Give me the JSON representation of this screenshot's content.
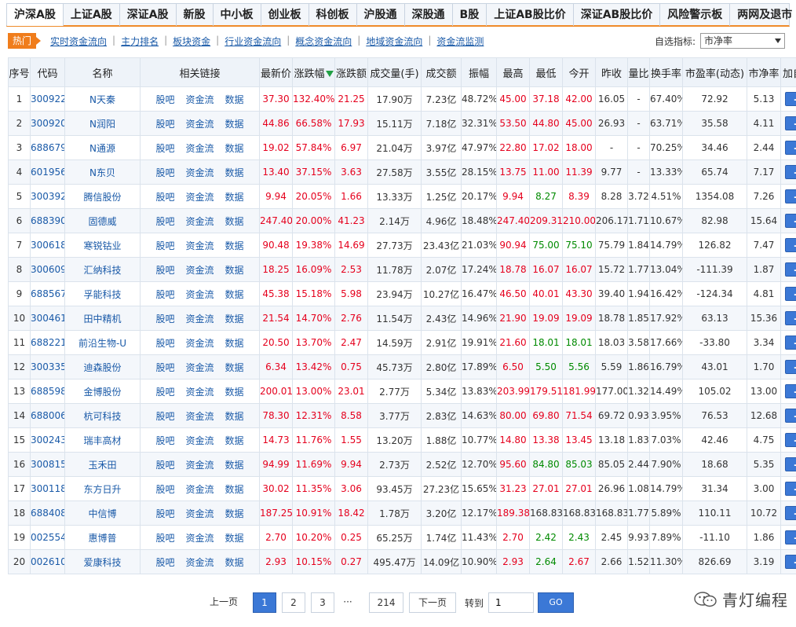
{
  "tabs": [
    "沪深A股",
    "上证A股",
    "深证A股",
    "新股",
    "中小板",
    "创业板",
    "科创板",
    "沪股通",
    "深股通",
    "B股",
    "上证AB股比价",
    "深证AB股比价",
    "风险警示板",
    "两网及退市"
  ],
  "subnav": {
    "hot": "热门",
    "links": [
      "实时资金流向",
      "主力排名",
      "板块资金",
      "行业资金流向",
      "概念资金流向",
      "地域资金流向",
      "资金流监测"
    ],
    "selector_label": "自选指标:",
    "selector_value": "市净率"
  },
  "table": {
    "headers": [
      "序号",
      "代码",
      "名称",
      "相关链接",
      "最新价",
      "涨跌幅",
      "涨跌额",
      "成交量(手)",
      "成交额",
      "振幅",
      "最高",
      "最低",
      "今开",
      "昨收",
      "量比",
      "换手率",
      "市盈率(动态)",
      "市净率",
      "加自选"
    ],
    "link_labels": [
      "股吧",
      "资金流",
      "数据"
    ],
    "add_label": "+",
    "rows": [
      {
        "no": "1",
        "code": "300922",
        "name": "N天秦",
        "price": "37.30",
        "pct": "132.40%",
        "chg": "21.25",
        "vol": "17.90万",
        "amt": "7.23亿",
        "amp": "48.72%",
        "high": "45.00",
        "low": "37.18",
        "open": "42.00",
        "prev": "16.05",
        "vr": "-",
        "turn": "67.40%",
        "pe": "72.92",
        "pb": "5.13",
        "cl": "rrrrrr"
      },
      {
        "no": "2",
        "code": "300920",
        "name": "N润阳",
        "price": "44.86",
        "pct": "66.58%",
        "chg": "17.93",
        "vol": "15.11万",
        "amt": "7.18亿",
        "amp": "32.31%",
        "high": "53.50",
        "low": "44.80",
        "open": "45.00",
        "prev": "26.93",
        "vr": "-",
        "turn": "63.71%",
        "pe": "35.58",
        "pb": "4.11",
        "cl": "rrrrrr"
      },
      {
        "no": "3",
        "code": "688679",
        "name": "N通源",
        "price": "19.02",
        "pct": "57.84%",
        "chg": "6.97",
        "vol": "21.04万",
        "amt": "3.97亿",
        "amp": "47.97%",
        "high": "22.80",
        "low": "17.02",
        "open": "18.00",
        "prev": "-",
        "vr": "-",
        "turn": "70.25%",
        "pe": "34.46",
        "pb": "2.44",
        "cl": "rrrrrr"
      },
      {
        "no": "4",
        "code": "601956",
        "name": "N东贝",
        "price": "13.40",
        "pct": "37.15%",
        "chg": "3.63",
        "vol": "27.58万",
        "amt": "3.55亿",
        "amp": "28.15%",
        "high": "13.75",
        "low": "11.00",
        "open": "11.39",
        "prev": "9.77",
        "vr": "-",
        "turn": "13.33%",
        "pe": "65.74",
        "pb": "7.17",
        "cl": "rrrrrr"
      },
      {
        "no": "5",
        "code": "300392",
        "name": "腾信股份",
        "price": "9.94",
        "pct": "20.05%",
        "chg": "1.66",
        "vol": "13.33万",
        "amt": "1.25亿",
        "amp": "20.17%",
        "high": "9.94",
        "low": "8.27",
        "open": "8.39",
        "prev": "8.28",
        "vr": "3.72",
        "turn": "4.51%",
        "pe": "1354.08",
        "pb": "7.26",
        "cl": "rrrrgr"
      },
      {
        "no": "6",
        "code": "688390",
        "name": "固德威",
        "price": "247.40",
        "pct": "20.00%",
        "chg": "41.23",
        "vol": "2.14万",
        "amt": "4.96亿",
        "amp": "18.48%",
        "high": "247.40",
        "low": "209.31",
        "open": "210.00",
        "prev": "206.17",
        "vr": "1.71",
        "turn": "10.67%",
        "pe": "82.98",
        "pb": "15.64",
        "cl": "rrrrrr"
      },
      {
        "no": "7",
        "code": "300618",
        "name": "寒锐钴业",
        "price": "90.48",
        "pct": "19.38%",
        "chg": "14.69",
        "vol": "27.73万",
        "amt": "23.43亿",
        "amp": "21.03%",
        "high": "90.94",
        "low": "75.00",
        "open": "75.10",
        "prev": "75.79",
        "vr": "1.84",
        "turn": "14.79%",
        "pe": "126.82",
        "pb": "7.47",
        "cl": "rrrrgg"
      },
      {
        "no": "8",
        "code": "300609",
        "name": "汇纳科技",
        "price": "18.25",
        "pct": "16.09%",
        "chg": "2.53",
        "vol": "11.78万",
        "amt": "2.07亿",
        "amp": "17.24%",
        "high": "18.78",
        "low": "16.07",
        "open": "16.07",
        "prev": "15.72",
        "vr": "1.77",
        "turn": "13.04%",
        "pe": "-111.39",
        "pb": "1.87",
        "cl": "rrrrrr"
      },
      {
        "no": "9",
        "code": "688567",
        "name": "孚能科技",
        "price": "45.38",
        "pct": "15.18%",
        "chg": "5.98",
        "vol": "23.94万",
        "amt": "10.27亿",
        "amp": "16.47%",
        "high": "46.50",
        "low": "40.01",
        "open": "43.30",
        "prev": "39.40",
        "vr": "1.94",
        "turn": "16.42%",
        "pe": "-124.34",
        "pb": "4.81",
        "cl": "rrrrrr"
      },
      {
        "no": "10",
        "code": "300461",
        "name": "田中精机",
        "price": "21.54",
        "pct": "14.70%",
        "chg": "2.76",
        "vol": "11.54万",
        "amt": "2.43亿",
        "amp": "14.96%",
        "high": "21.90",
        "low": "19.09",
        "open": "19.09",
        "prev": "18.78",
        "vr": "1.85",
        "turn": "17.92%",
        "pe": "63.13",
        "pb": "15.36",
        "cl": "rrrrrr"
      },
      {
        "no": "11",
        "code": "688221",
        "name": "前沿生物-U",
        "price": "20.50",
        "pct": "13.70%",
        "chg": "2.47",
        "vol": "14.59万",
        "amt": "2.91亿",
        "amp": "19.91%",
        "high": "21.60",
        "low": "18.01",
        "open": "18.01",
        "prev": "18.03",
        "vr": "3.58",
        "turn": "17.66%",
        "pe": "-33.80",
        "pb": "3.34",
        "cl": "rrrrgg"
      },
      {
        "no": "12",
        "code": "300335",
        "name": "迪森股份",
        "price": "6.34",
        "pct": "13.42%",
        "chg": "0.75",
        "vol": "45.73万",
        "amt": "2.80亿",
        "amp": "17.89%",
        "high": "6.50",
        "low": "5.50",
        "open": "5.56",
        "prev": "5.59",
        "vr": "1.86",
        "turn": "16.79%",
        "pe": "43.01",
        "pb": "1.70",
        "cl": "rrrrgg"
      },
      {
        "no": "13",
        "code": "688598",
        "name": "金博股份",
        "price": "200.01",
        "pct": "13.00%",
        "chg": "23.01",
        "vol": "2.77万",
        "amt": "5.34亿",
        "amp": "13.83%",
        "high": "203.99",
        "low": "179.51",
        "open": "181.99",
        "prev": "177.00",
        "vr": "1.32",
        "turn": "14.49%",
        "pe": "105.02",
        "pb": "13.00",
        "cl": "rrrrrr"
      },
      {
        "no": "14",
        "code": "688006",
        "name": "杭可科技",
        "price": "78.30",
        "pct": "12.31%",
        "chg": "8.58",
        "vol": "3.77万",
        "amt": "2.83亿",
        "amp": "14.63%",
        "high": "80.00",
        "low": "69.80",
        "open": "71.54",
        "prev": "69.72",
        "vr": "0.93",
        "turn": "3.95%",
        "pe": "76.53",
        "pb": "12.68",
        "cl": "rrrrrr"
      },
      {
        "no": "15",
        "code": "300243",
        "name": "瑞丰高材",
        "price": "14.73",
        "pct": "11.76%",
        "chg": "1.55",
        "vol": "13.20万",
        "amt": "1.88亿",
        "amp": "10.77%",
        "high": "14.80",
        "low": "13.38",
        "open": "13.45",
        "prev": "13.18",
        "vr": "1.83",
        "turn": "7.03%",
        "pe": "42.46",
        "pb": "4.75",
        "cl": "rrrrrr"
      },
      {
        "no": "16",
        "code": "300815",
        "name": "玉禾田",
        "price": "94.99",
        "pct": "11.69%",
        "chg": "9.94",
        "vol": "2.73万",
        "amt": "2.52亿",
        "amp": "12.70%",
        "high": "95.60",
        "low": "84.80",
        "open": "85.03",
        "prev": "85.05",
        "vr": "2.44",
        "turn": "7.90%",
        "pe": "18.68",
        "pb": "5.35",
        "cl": "rrrrgg"
      },
      {
        "no": "17",
        "code": "300118",
        "name": "东方日升",
        "price": "30.02",
        "pct": "11.35%",
        "chg": "3.06",
        "vol": "93.45万",
        "amt": "27.23亿",
        "amp": "15.65%",
        "high": "31.23",
        "low": "27.01",
        "open": "27.01",
        "prev": "26.96",
        "vr": "1.08",
        "turn": "14.79%",
        "pe": "31.34",
        "pb": "3.00",
        "cl": "rrrrrr"
      },
      {
        "no": "18",
        "code": "688408",
        "name": "中信博",
        "price": "187.25",
        "pct": "10.91%",
        "chg": "18.42",
        "vol": "1.78万",
        "amt": "3.20亿",
        "amp": "12.17%",
        "high": "189.38",
        "low": "168.83",
        "open": "168.83",
        "prev": "168.83",
        "vr": "1.77",
        "turn": "5.89%",
        "pe": "110.11",
        "pb": "10.72",
        "cl": "rrrrnn"
      },
      {
        "no": "19",
        "code": "002554",
        "name": "惠博普",
        "price": "2.70",
        "pct": "10.20%",
        "chg": "0.25",
        "vol": "65.25万",
        "amt": "1.74亿",
        "amp": "11.43%",
        "high": "2.70",
        "low": "2.42",
        "open": "2.43",
        "prev": "2.45",
        "vr": "9.93",
        "turn": "7.89%",
        "pe": "-11.10",
        "pb": "1.86",
        "cl": "rrrrgg"
      },
      {
        "no": "20",
        "code": "002610",
        "name": "爱康科技",
        "price": "2.93",
        "pct": "10.15%",
        "chg": "0.27",
        "vol": "495.47万",
        "amt": "14.09亿",
        "amp": "10.90%",
        "high": "2.93",
        "low": "2.64",
        "open": "2.67",
        "prev": "2.66",
        "vr": "1.52",
        "turn": "11.30%",
        "pe": "826.69",
        "pb": "3.19",
        "cl": "rrrrgr"
      }
    ]
  },
  "pagination": {
    "prev": "上一页",
    "pages": [
      "1",
      "2",
      "3"
    ],
    "ellipsis": "···",
    "last": "214",
    "next": "下一页",
    "goto_label": "转到",
    "goto_value": "1",
    "go": "GO"
  },
  "watermark": {
    "text": "青灯编程",
    "icon": "wechat-icon"
  },
  "colors": {
    "up": "#e5001d",
    "down": "#008a00",
    "link": "#1a5aa8",
    "accent": "#f07d1c",
    "button": "#3b78d6"
  }
}
